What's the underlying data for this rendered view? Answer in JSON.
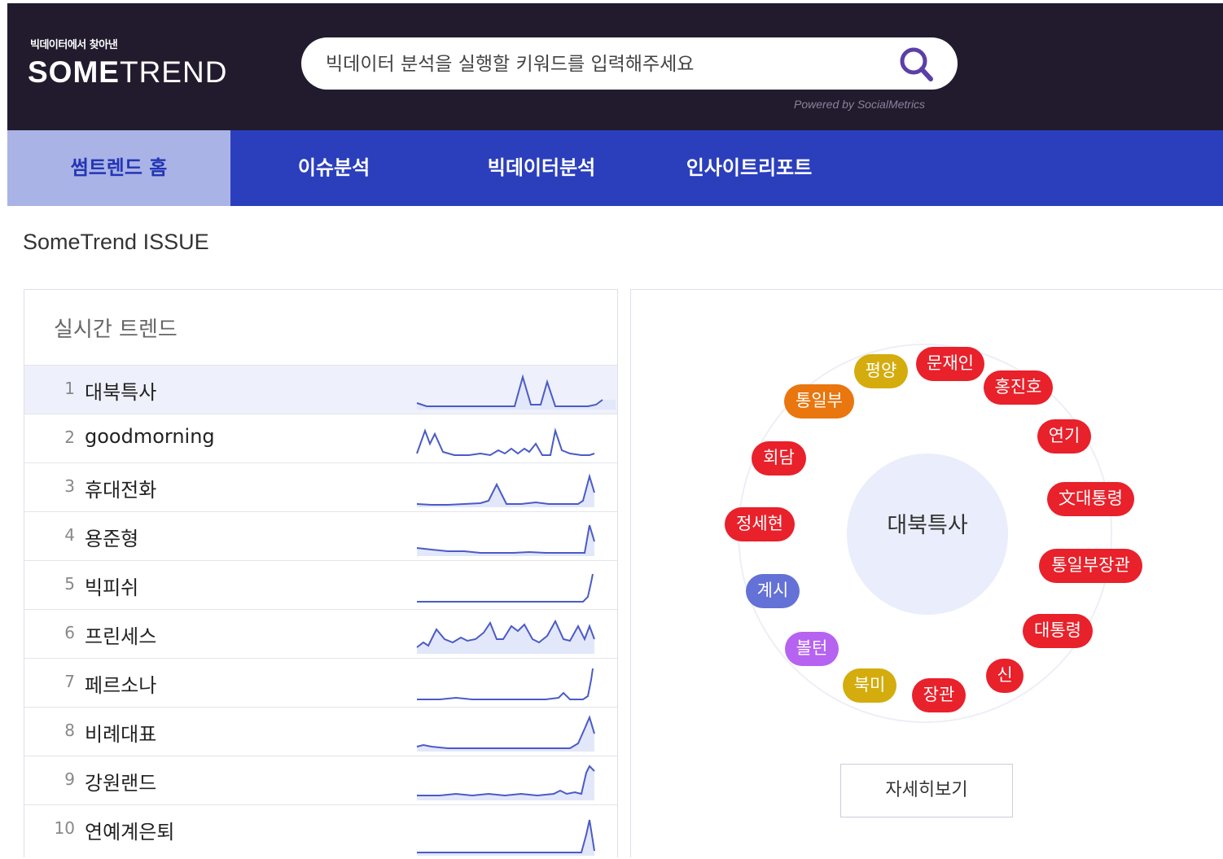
{
  "header": {
    "brand_tagline": "빅데이터에서 찾아낸",
    "brand_some": "SOME",
    "brand_trend": "TREND",
    "search_placeholder": "빅데이터 분석을 실행할 키워드를 입력해주세요",
    "search_icon": "search-icon",
    "powered_by": "Powered by SocialMetrics"
  },
  "colors": {
    "header_bg": "#221b2e",
    "nav_bg": "#2b3fbd",
    "nav_active_bg": "#aab3e6",
    "accent_purple": "#5b3fa8",
    "sparkline": "#4a5bc6",
    "red": "#e8212b",
    "orange": "#e9760e",
    "yellow": "#d4ac0d",
    "blue": "#6471d6",
    "violet": "#b563f0"
  },
  "nav": {
    "items": [
      {
        "label": "썸트렌드 홈",
        "active": true
      },
      {
        "label": "이슈분석",
        "active": false
      },
      {
        "label": "빅데이터분석",
        "active": false
      },
      {
        "label": "인사이트리포트",
        "active": false
      }
    ]
  },
  "section_title": "SomeTrend ISSUE",
  "realtime": {
    "title": "실시간 트렌드",
    "items": [
      {
        "rank": "1",
        "keyword": "대북특사",
        "spark": [
          20,
          21,
          22,
          22,
          22,
          22,
          22,
          22,
          22,
          22,
          22,
          22,
          22,
          22,
          22,
          22,
          22,
          22,
          22,
          22,
          22,
          22,
          22,
          22,
          22,
          22,
          22,
          22,
          22,
          22,
          22,
          22,
          22,
          22,
          22,
          22,
          22,
          22,
          22,
          22,
          22,
          22,
          22,
          22,
          22,
          22,
          22,
          22,
          22,
          22,
          22,
          22,
          22,
          22,
          22,
          22,
          22,
          22,
          22,
          22,
          22,
          22,
          22,
          22,
          22,
          22,
          22,
          22,
          22,
          22
        ]
      },
      {
        "rank": "2",
        "keyword": "goodmorning",
        "spark": []
      },
      {
        "rank": "3",
        "keyword": "휴대전화",
        "spark": []
      },
      {
        "rank": "4",
        "keyword": "용준형",
        "spark": []
      },
      {
        "rank": "5",
        "keyword": "빅피쉬",
        "spark": []
      },
      {
        "rank": "6",
        "keyword": "프린세스",
        "spark": []
      },
      {
        "rank": "7",
        "keyword": "페르소나",
        "spark": []
      },
      {
        "rank": "8",
        "keyword": "비례대표",
        "spark": []
      },
      {
        "rank": "9",
        "keyword": "강원랜드",
        "spark": []
      },
      {
        "rank": "10",
        "keyword": "연예계은퇴",
        "spark": []
      }
    ]
  },
  "cloud": {
    "center": "대북특사",
    "keywords": [
      {
        "label": "평양",
        "color": "yellow"
      },
      {
        "label": "문재인",
        "color": "red"
      },
      {
        "label": "홍진호",
        "color": "red"
      },
      {
        "label": "통일부",
        "color": "orange"
      },
      {
        "label": "연기",
        "color": "red"
      },
      {
        "label": "회담",
        "color": "red"
      },
      {
        "label": "文대통령",
        "color": "red"
      },
      {
        "label": "정세현",
        "color": "red"
      },
      {
        "label": "통일부장관",
        "color": "red"
      },
      {
        "label": "계시",
        "color": "blue"
      },
      {
        "label": "대통령",
        "color": "red"
      },
      {
        "label": "볼턴",
        "color": "violet"
      },
      {
        "label": "신",
        "color": "red"
      },
      {
        "label": "북미",
        "color": "yellow"
      },
      {
        "label": "장관",
        "color": "red"
      }
    ],
    "detail_button": "자세히보기"
  }
}
